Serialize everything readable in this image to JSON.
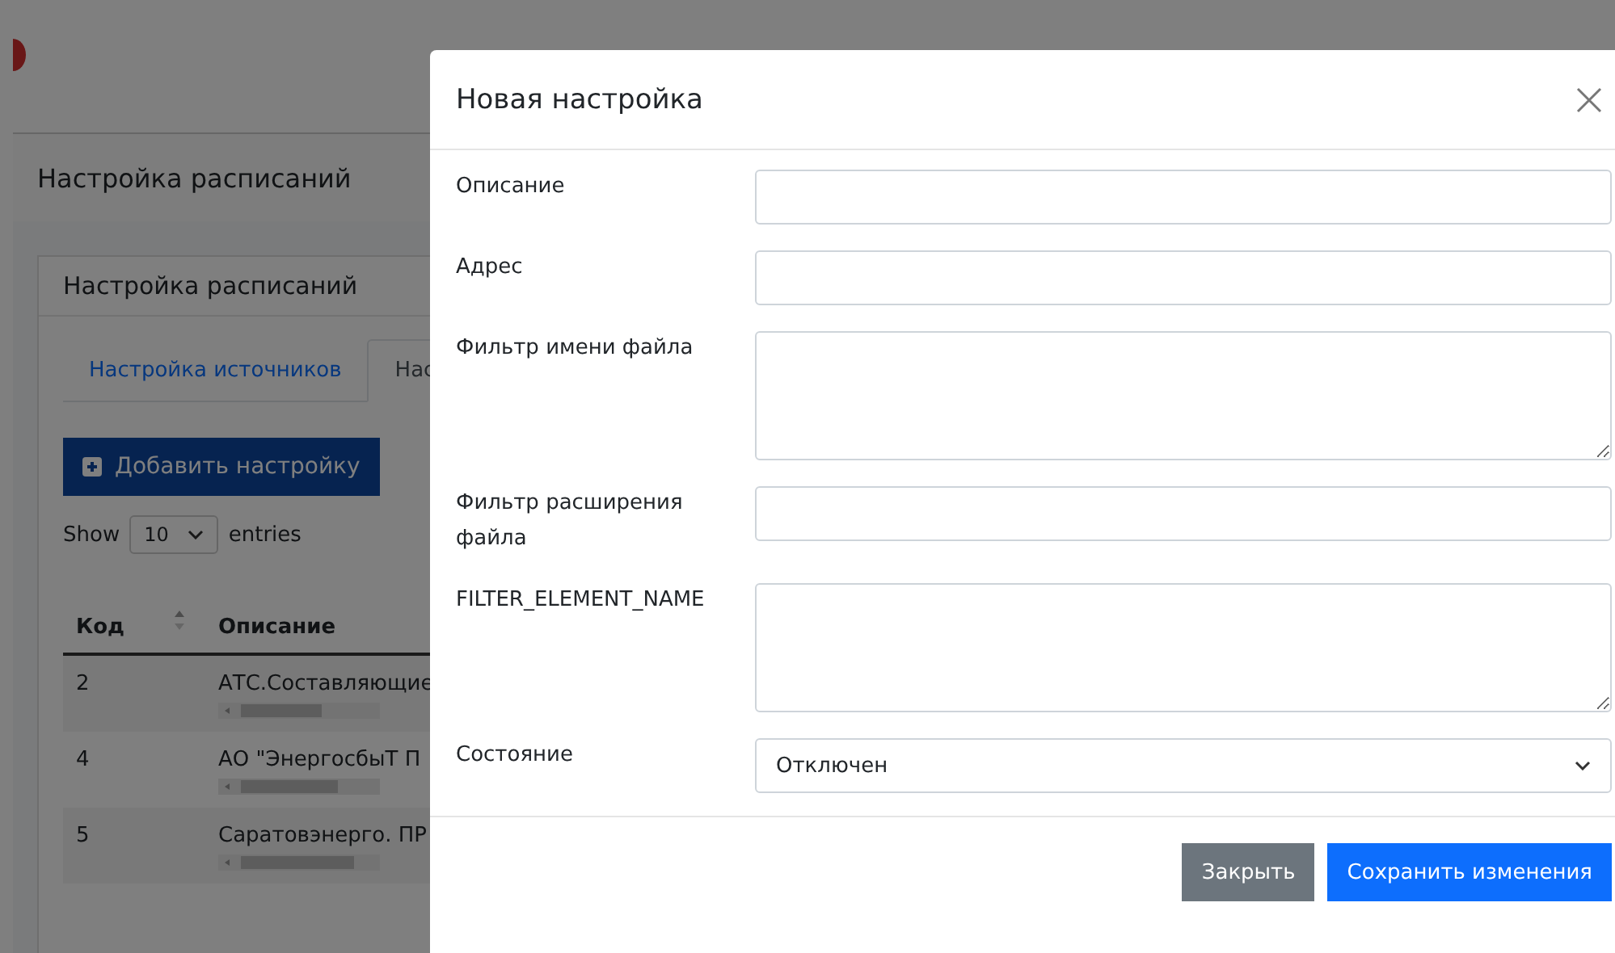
{
  "page": {
    "title": "Настройка расписаний"
  },
  "card": {
    "title": "Настройка расписаний",
    "tabs": [
      {
        "label": "Настройка источников",
        "selected": false
      },
      {
        "label": "Нас",
        "selected": true
      }
    ],
    "add_button": "Добавить настройку",
    "length": {
      "prefix": "Show",
      "value": "10",
      "suffix": "entries"
    },
    "table": {
      "columns": [
        "Код",
        "Описание"
      ],
      "rows": [
        {
          "cells": [
            "2",
            "АТС.Составляющие"
          ]
        },
        {
          "cells": [
            "4",
            "АО \"ЭнергосбыТ П"
          ]
        },
        {
          "cells": [
            "5",
            "Саратовэнерго. ПР"
          ]
        }
      ]
    }
  },
  "modal": {
    "title": "Новая настройка",
    "fields": [
      {
        "label": "Описание",
        "kind": "text"
      },
      {
        "label": "Адрес",
        "kind": "text"
      },
      {
        "label": "Фильтр имени файла",
        "kind": "textarea"
      },
      {
        "label": "Фильтр расширения файла",
        "kind": "text"
      },
      {
        "label": "FILTER_ELEMENT_NAME",
        "kind": "textarea"
      },
      {
        "label": "Состояние",
        "kind": "select",
        "value": "Отключен"
      }
    ],
    "buttons": [
      {
        "label": "Закрыть",
        "kind": "secondary"
      },
      {
        "label": "Сохранить изменения",
        "kind": "primary"
      }
    ]
  }
}
